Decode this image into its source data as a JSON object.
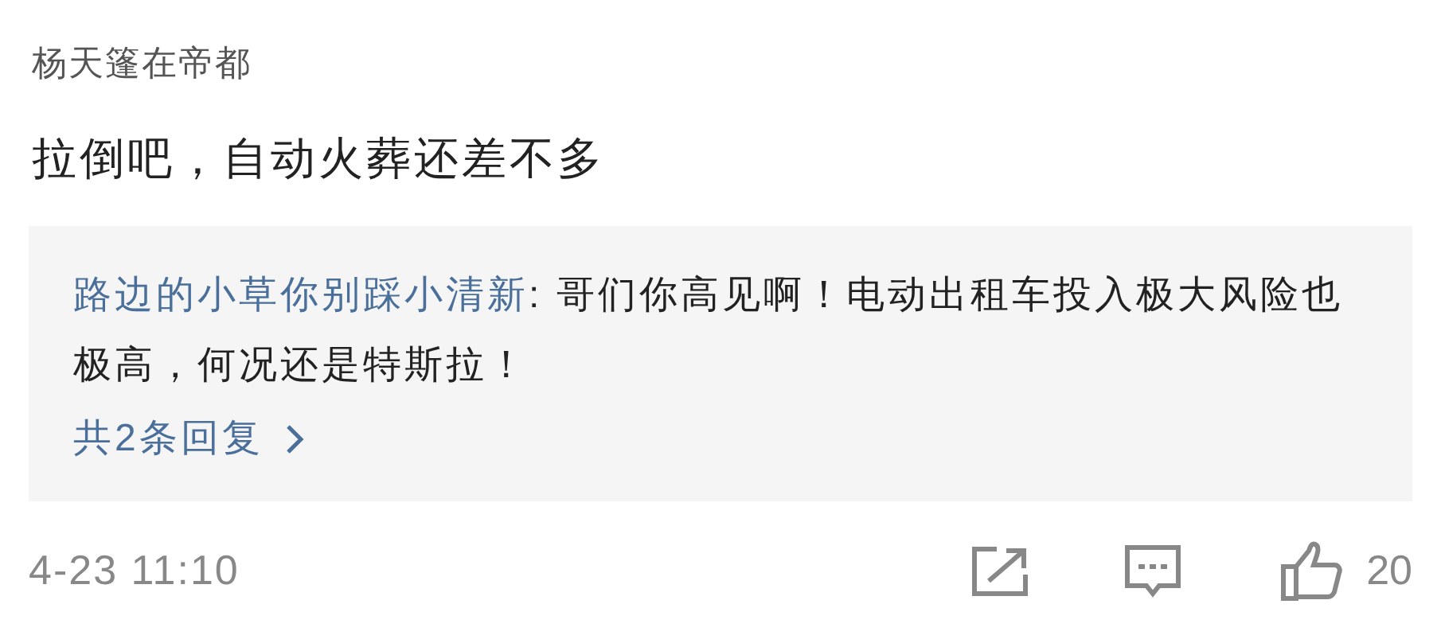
{
  "comment": {
    "author": "杨天篷在帝都",
    "text": "拉倒吧，自动火葬还差不多"
  },
  "reply_preview": {
    "author": "路边的小草你别踩小清新",
    "text": ": 哥们你高见啊！电动出租车投入极大风险也极高，何况还是特斯拉！",
    "more_link": "共2条回复"
  },
  "footer": {
    "time": "4-23 11:10",
    "like_count": "20"
  }
}
